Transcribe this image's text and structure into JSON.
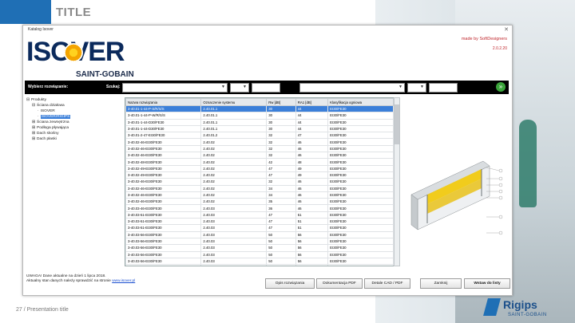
{
  "slide": {
    "title": "TITLE",
    "footer": "27 / Presentation title",
    "brand_name": "Rigips",
    "brand_sub": "SAINT-GOBAIN",
    "accent": "#1f6fb5"
  },
  "window": {
    "title": "Katalog Isover",
    "close": "✕",
    "logo_word": "ISOVER",
    "logo_sub": "SAINT-GOBAIN",
    "made_by": "made by SoftDesigners",
    "version": "2.0.2.20"
  },
  "toolbar": {
    "filter_label": "Wybierz rozwiązanie:",
    "search_label": "Szukaj:",
    "go_icon": "»"
  },
  "tree": [
    {
      "toggle": "⊟",
      "label": "Produkty",
      "indent": 0
    },
    {
      "toggle": "⊟",
      "label": "Ściana działowa",
      "indent": 1
    },
    {
      "toggle": "·",
      "label": "ISOVER",
      "indent": 2
    },
    {
      "toggle": "·",
      "label": "ISOVER/RIGIPS",
      "indent": 2,
      "selected": true
    },
    {
      "toggle": "⊞",
      "label": "Ściana zewnętrzna",
      "indent": 1
    },
    {
      "toggle": "⊞",
      "label": "Podłoga pływająca",
      "indent": 1
    },
    {
      "toggle": "⊞",
      "label": "Dach skośny",
      "indent": 1
    },
    {
      "toggle": "⊞",
      "label": "Dach płaski",
      "indent": 1
    }
  ],
  "grid": {
    "columns": [
      "Nazwa rozwiązania",
      "Oznaczenie systemu",
      "Rw [dB]",
      "RA1 [dB]",
      "Klasyfikacja ogniowa"
    ],
    "rows": [
      [
        "3-40.01-1-44-P-S/R/S/S",
        "2.40.01.1",
        "30",
        "44",
        "EI30/FE30"
      ],
      [
        "3-40.01-1-44-P-W/R/S/S",
        "2.40.01.1",
        "30",
        "44",
        "EI30/FE30"
      ],
      [
        "3-40.01-1-44-D30/FE30",
        "2.40.01.1",
        "30",
        "44",
        "EI30/FE30"
      ],
      [
        "3-40.01-1-44-D30/FE30",
        "2.40.01.1",
        "30",
        "44",
        "EI30/FE30"
      ],
      [
        "3-40.01-2-47-EI30/FE30",
        "2.40.01.2",
        "32",
        "47",
        "EI30/FE30"
      ],
      [
        "3-40.02-46-EI30/FE30",
        "2.40.02",
        "32",
        "46",
        "EI30/FE30"
      ],
      [
        "3-40.02-46-EI30/FE30",
        "2.40.02",
        "32",
        "46",
        "EI30/FE30"
      ],
      [
        "3-40.02-46-EI30/FE30",
        "2.40.02",
        "32",
        "46",
        "EI30/FE30"
      ],
      [
        "3-40.02-48-EI30/FE30",
        "2.40.02",
        "42",
        "48",
        "EI30/FE30"
      ],
      [
        "3-40.02-49-EI30/FE30",
        "2.40.02",
        "47",
        "49",
        "EI30/FE30"
      ],
      [
        "3-40.02-49-EI30/FE30",
        "2.40.02",
        "47",
        "49",
        "EI30/FE30"
      ],
      [
        "3-40.02-46-EI30/FE30",
        "2.40.02",
        "32",
        "46",
        "EI30/FE30"
      ],
      [
        "3-40.02-46-EI30/FE30",
        "2.40.02",
        "34",
        "46",
        "EI30/FE30"
      ],
      [
        "3-40.02-46-EI30/FE30",
        "2.40.02",
        "34",
        "46",
        "EI30/FE30"
      ],
      [
        "3-40.02-46-EI30/FE30",
        "2.40.02",
        "35",
        "46",
        "EI30/FE30"
      ],
      [
        "3-40.03-46-EI30/FE30",
        "2.40.03",
        "36",
        "46",
        "EI30/FE30"
      ],
      [
        "3-40.03-51-EI30/FE30",
        "2.40.03",
        "47",
        "51",
        "EI30/FE30"
      ],
      [
        "3-40.03-51-EI30/FE30",
        "2.40.03",
        "47",
        "51",
        "EI30/FE30"
      ],
      [
        "3-40.03-51-EI30/FE30",
        "2.40.03",
        "47",
        "51",
        "EI30/FE30"
      ],
      [
        "3-40.03-56-EI30/FE30",
        "2.40.03",
        "50",
        "56",
        "EI30/FE30"
      ],
      [
        "3-40.03-56-EI30/FE30",
        "2.40.03",
        "50",
        "56",
        "EI30/FE30"
      ],
      [
        "3-40.03-56-EI30/FE30",
        "2.40.03",
        "50",
        "56",
        "EI30/FE30"
      ],
      [
        "3-40.03-56-EI30/FE30",
        "2.40.03",
        "50",
        "56",
        "EI30/FE30"
      ],
      [
        "3-40.03-56-EI30/FE30",
        "2.40.03",
        "50",
        "56",
        "EI30/FE30"
      ],
      [
        "3-40.03-56-EI30/FE30",
        "2.40.03",
        "50",
        "56",
        "EI30/FE30"
      ],
      [
        "3-40.03-56-EI30/FE30",
        "2.40.03",
        "50",
        "56",
        "EI30/FE30"
      ],
      [
        "3-40.03-56-EI30/FE30",
        "2.40.03",
        "50",
        "56",
        "EI30/FE30"
      ]
    ],
    "selected_index": 0
  },
  "notice": {
    "line1": "UWAGA! Dane aktualne na dzień 1 lipca 2018.",
    "line2_prefix": "Aktualny stan danych należy sprawdzić na stronie ",
    "link": "www.isover.pl"
  },
  "buttons": {
    "description": "Opis rozwiązania",
    "documentation": "Dokumentacja PDF",
    "cad_details": "Detale CAD / PDF",
    "close": "Zamknij",
    "insert": "Wstaw do listy"
  }
}
